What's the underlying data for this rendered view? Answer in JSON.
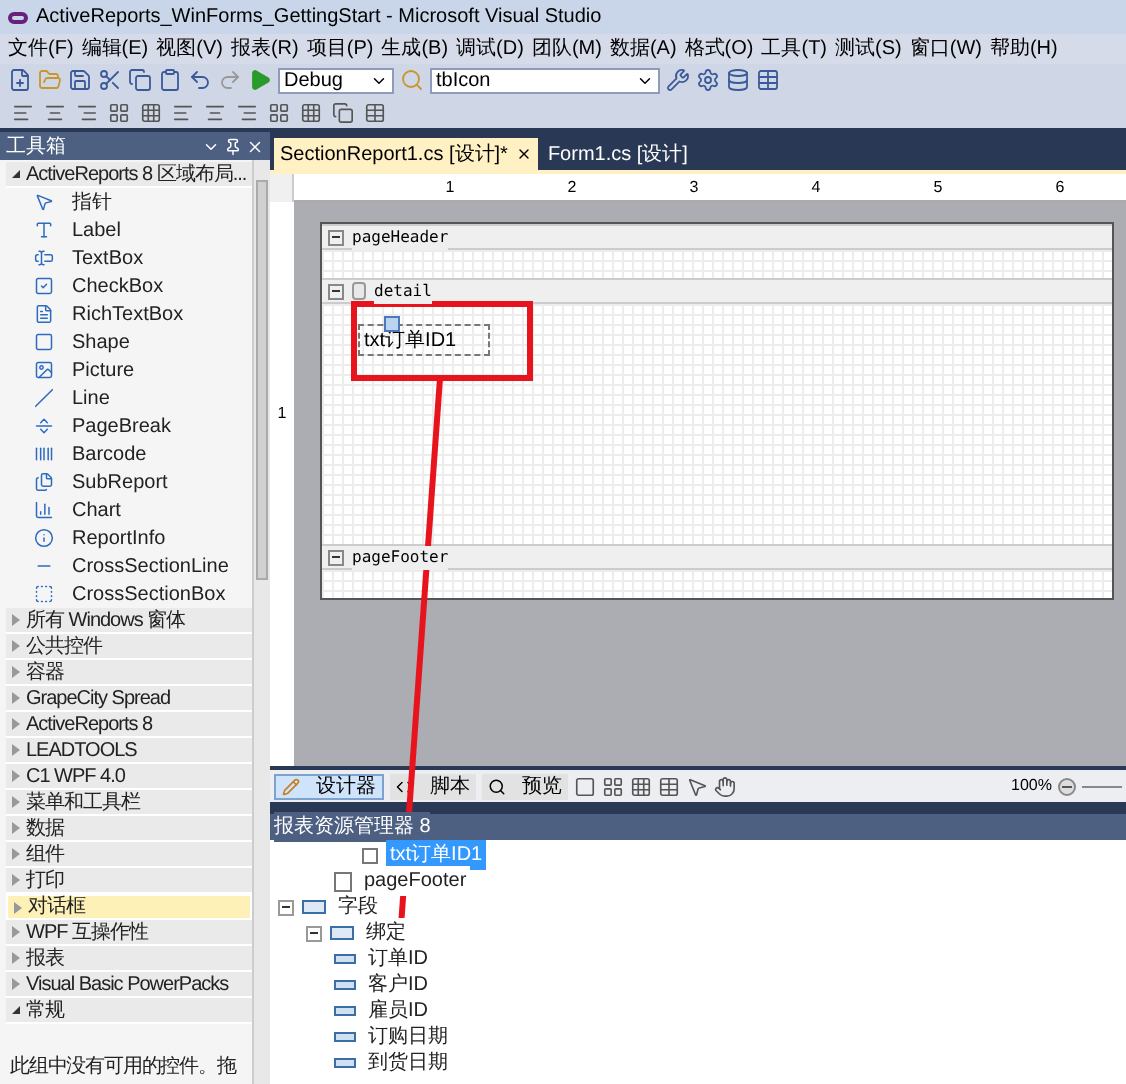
{
  "window": {
    "title": "ActiveReports_WinForms_GettingStart - Microsoft Visual Studio"
  },
  "menu": [
    "文件(F)",
    "编辑(E)",
    "视图(V)",
    "报表(R)",
    "项目(P)",
    "生成(B)",
    "调试(D)",
    "团队(M)",
    "数据(A)",
    "格式(O)",
    "工具(T)",
    "测试(S)",
    "窗口(W)",
    "帮助(H)"
  ],
  "toolbar": {
    "configuration": "Debug",
    "find": "tbIcon"
  },
  "toolbox": {
    "title": "工具箱",
    "groups": [
      {
        "label": "ActiveReports 8 区域布局...",
        "expanded": true,
        "selected": false,
        "items": [
          "指针",
          "Label",
          "TextBox",
          "CheckBox",
          "RichTextBox",
          "Shape",
          "Picture",
          "Line",
          "PageBreak",
          "Barcode",
          "SubReport",
          "Chart",
          "ReportInfo",
          "CrossSectionLine",
          "CrossSectionBox"
        ]
      },
      {
        "label": "所有 Windows 窗体",
        "expanded": false,
        "selected": false
      },
      {
        "label": "公共控件",
        "expanded": false,
        "selected": false
      },
      {
        "label": "容器",
        "expanded": false,
        "selected": false
      },
      {
        "label": "GrapeCity Spread",
        "expanded": false,
        "selected": false
      },
      {
        "label": "ActiveReports 8",
        "expanded": false,
        "selected": false
      },
      {
        "label": "LEADTOOLS",
        "expanded": false,
        "selected": false
      },
      {
        "label": "C1 WPF 4.0",
        "expanded": false,
        "selected": false
      },
      {
        "label": "菜单和工具栏",
        "expanded": false,
        "selected": false
      },
      {
        "label": "数据",
        "expanded": false,
        "selected": false
      },
      {
        "label": "组件",
        "expanded": false,
        "selected": false
      },
      {
        "label": "打印",
        "expanded": false,
        "selected": false
      },
      {
        "label": "对话框",
        "expanded": false,
        "selected": true
      },
      {
        "label": "WPF 互操作性",
        "expanded": false,
        "selected": false
      },
      {
        "label": "报表",
        "expanded": false,
        "selected": false
      },
      {
        "label": "Visual Basic PowerPacks",
        "expanded": false,
        "selected": false
      },
      {
        "label": "常规",
        "expanded": true,
        "selected": false,
        "empty_text": "此组中没有可用的控件。拖"
      }
    ]
  },
  "document_tabs": [
    {
      "label": "SectionReport1.cs [设计]*",
      "selected": true
    },
    {
      "label": "Form1.cs [设计]",
      "selected": false
    }
  ],
  "ruler": {
    "marks": [
      "1",
      "2",
      "3",
      "4",
      "5",
      "6"
    ],
    "vertical_marks": [
      "1"
    ]
  },
  "report": {
    "sections": [
      {
        "name": "pageHeader",
        "kind": "header"
      },
      {
        "name": "detail",
        "kind": "detail",
        "textbox": "txt订单ID1"
      },
      {
        "name": "pageFooter",
        "kind": "footer"
      }
    ]
  },
  "designer_tabs": [
    {
      "label": "设计器",
      "selected": true
    },
    {
      "label": "脚本",
      "selected": false
    },
    {
      "label": "预览",
      "selected": false
    }
  ],
  "zoom": "100%",
  "explorer": {
    "title": "报表资源管理器 8",
    "tree": [
      {
        "label": "txt订单ID1",
        "kind": "control",
        "selected": true
      },
      {
        "label": "pageFooter",
        "kind": "section",
        "selected": false
      },
      {
        "label": "字段",
        "kind": "folder",
        "selected": false,
        "expanded": true,
        "children": [
          {
            "label": "绑定",
            "kind": "folder",
            "selected": false,
            "expanded": true,
            "children": [
              {
                "label": "订单ID",
                "kind": "field",
                "selected": false
              },
              {
                "label": "客户ID",
                "kind": "field",
                "selected": false
              },
              {
                "label": "雇员ID",
                "kind": "field",
                "selected": false
              },
              {
                "label": "订购日期",
                "kind": "field",
                "selected": false
              },
              {
                "label": "到货日期",
                "kind": "field",
                "selected": false
              }
            ]
          }
        ]
      }
    ]
  }
}
